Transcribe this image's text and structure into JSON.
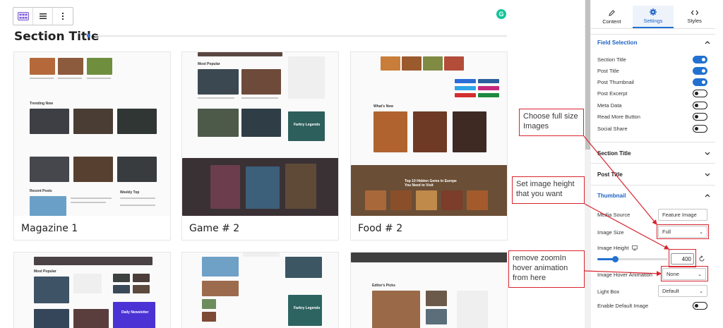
{
  "toolbar": {
    "icons": [
      "grid-icon",
      "align-icon",
      "more-options-icon"
    ]
  },
  "grammarly_label": "G",
  "section_title": "Section Title",
  "cards": [
    {
      "label": "Magazine 1",
      "thumb_headings": [
        "Trending Now",
        "Recent Posts",
        "Weekly Top"
      ]
    },
    {
      "label": "Game # 2",
      "thumb_headings": [
        "Most Popular",
        "Farkry Legends"
      ]
    },
    {
      "label": "Food # 2",
      "thumb_headings": [
        "What's New",
        "Top 10 Hidden Gems in Europe You Need to Visit"
      ]
    },
    {
      "label": "",
      "thumb_headings": [
        "Most Popular",
        "Daily Newsletter"
      ]
    },
    {
      "label": "",
      "thumb_headings": [
        "Farkry Legends"
      ]
    },
    {
      "label": "",
      "thumb_headings": [
        "Editor's Picks"
      ]
    }
  ],
  "panel": {
    "tabs": [
      {
        "label": "Content",
        "icon": "pencil-icon"
      },
      {
        "label": "Settings",
        "icon": "gear-icon",
        "active": true
      },
      {
        "label": "Styles",
        "icon": "code-icon"
      }
    ],
    "field_selection": {
      "title": "Field Selection",
      "rows": [
        {
          "label": "Section Title",
          "on": true
        },
        {
          "label": "Post Title",
          "on": true
        },
        {
          "label": "Post Thumbnail",
          "on": true
        },
        {
          "label": "Post Excerpt",
          "on": false
        },
        {
          "label": "Meta Data",
          "on": false
        },
        {
          "label": "Read More Button",
          "on": false
        },
        {
          "label": "Social Share",
          "on": false
        }
      ]
    },
    "collapsed_sections": [
      "Section Title",
      "Post Title"
    ],
    "thumbnail": {
      "title": "Thumbnail",
      "media_source_label": "Media Source",
      "media_source_value": "Feature Image",
      "image_size_label": "Image Size",
      "image_size_value": "Full",
      "image_height_label": "Image Height",
      "image_height_value": "400",
      "image_height_slider": 0.25,
      "hover_animation_label": "Image Hover Animation",
      "hover_animation_value": "None",
      "light_box_label": "Light Box",
      "light_box_value": "Default",
      "enable_default_label": "Enable Default Image",
      "enable_default_on": false
    }
  },
  "annotations": [
    {
      "text": "Choose full size Images"
    },
    {
      "text": "Set image height that you want"
    },
    {
      "text": "remove zoomIn hover animation from here"
    }
  ],
  "colors": {
    "accent": "#2271d1",
    "annotation": "#d9232d",
    "grammarly": "#15c39a"
  }
}
